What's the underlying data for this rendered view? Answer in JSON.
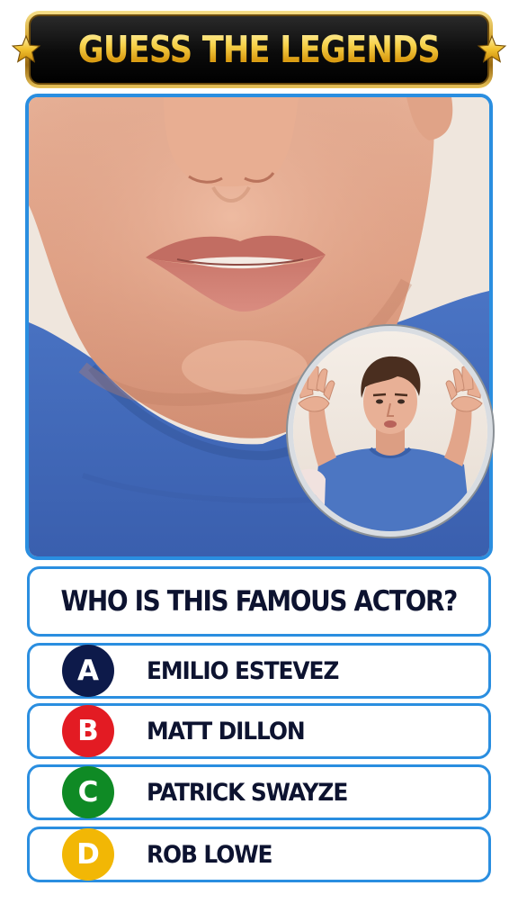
{
  "title": {
    "text": "GUESS THE LEGENDS",
    "star_icon": "star-icon",
    "text_color": "#f5c93a"
  },
  "photo": {
    "main_image": "close-up-of-mouth-and-chin-in-blue-t-shirt",
    "inset_image": "young-man-with-raised-hands-in-blue-t-shirt"
  },
  "question": {
    "text": "WHO IS THIS FAMOUS ACTOR?"
  },
  "answers": [
    {
      "letter": "A",
      "text": "EMILIO ESTEVEZ",
      "color": "#0d1a4a"
    },
    {
      "letter": "B",
      "text": "MATT DILLON",
      "color": "#e31b23"
    },
    {
      "letter": "C",
      "text": "PATRICK SWAYZE",
      "color": "#0f8a25"
    },
    {
      "letter": "D",
      "text": "ROB LOWE",
      "color": "#f2b705"
    }
  ],
  "colors": {
    "accent_border": "#2a8ee0",
    "question_text": "#0d1330"
  }
}
